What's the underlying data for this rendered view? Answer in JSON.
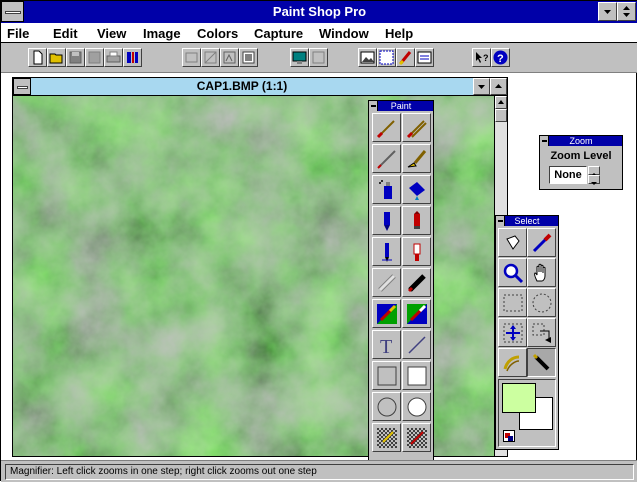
{
  "app": {
    "title": "Paint Shop Pro"
  },
  "menu": {
    "items": [
      "File",
      "Edit",
      "View",
      "Image",
      "Colors",
      "Capture",
      "Window",
      "Help"
    ]
  },
  "toolbar": {
    "buttons": [
      "new-icon",
      "open-icon",
      "save-icon",
      "save-as-icon",
      "print-icon",
      "scan-icon",
      "undo-icon",
      "crop-icon",
      "flip-icon",
      "rotate-icon",
      "slideshow-icon",
      "capture-icon",
      "palette-icon",
      "grid-icon",
      "paint-icon",
      "status-icon",
      "context-help-icon",
      "help-icon"
    ]
  },
  "image_window": {
    "title": "CAP1.BMP (1:1)"
  },
  "paint_palette": {
    "title": "Paint",
    "tools": [
      "paintbrush",
      "pen",
      "pencil",
      "charcoal",
      "airbrush",
      "fill-bucket",
      "marker",
      "crayon",
      "highlighter",
      "lipstick",
      "eraser",
      "smudge",
      "color-replacer",
      "clone-brush",
      "text",
      "line",
      "rectangle",
      "filled-rectangle",
      "ellipse",
      "filled-ellipse",
      "pattern-a",
      "pattern-b"
    ]
  },
  "select_palette": {
    "title": "Select",
    "tools": [
      "lasso",
      "eyedropper",
      "magnifier",
      "hand",
      "rect-select",
      "ellipse-select",
      "move",
      "deformation",
      "magic-wand",
      "retouch"
    ]
  },
  "zoom_palette": {
    "title": "Zoom",
    "label": "Zoom Level",
    "value": "None"
  },
  "colors": {
    "foreground": "#ccffa0",
    "background": "#ffffff",
    "canvas_dark": "#0b1f07",
    "canvas_light": "#3cdc2c",
    "titlebar": "#0000a8"
  },
  "status": {
    "text": "Magnifier: Left click zooms in one step; right click zooms out one step"
  }
}
